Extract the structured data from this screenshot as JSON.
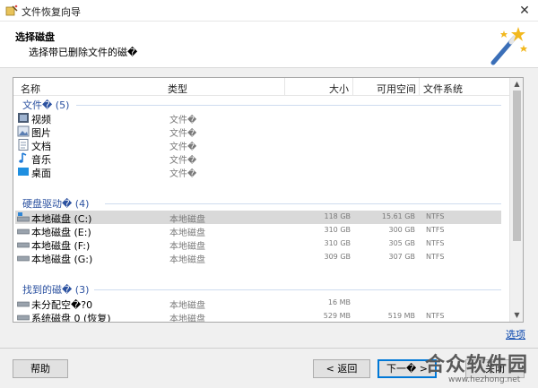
{
  "window": {
    "title": "文件恢复向导",
    "close_glyph": "✕"
  },
  "header": {
    "title": "选择磁盘",
    "subtitle": "选择带已删除文件的磁�"
  },
  "columns": {
    "name": "名称",
    "type": "类型",
    "size": "大小",
    "free": "可用空间",
    "fs": "文件系统"
  },
  "groups": [
    {
      "label": "文件� (5)",
      "rows": [
        {
          "name": "视频",
          "type": "文件�",
          "size": "",
          "free": "",
          "fs": "",
          "icon": "video-icon"
        },
        {
          "name": "图片",
          "type": "文件�",
          "size": "",
          "free": "",
          "fs": "",
          "icon": "picture-icon"
        },
        {
          "name": "文档",
          "type": "文件�",
          "size": "",
          "free": "",
          "fs": "",
          "icon": "document-icon"
        },
        {
          "name": "音乐",
          "type": "文件�",
          "size": "",
          "free": "",
          "fs": "",
          "icon": "music-icon"
        },
        {
          "name": "桌面",
          "type": "文件�",
          "size": "",
          "free": "",
          "fs": "",
          "icon": "desktop-icon"
        }
      ]
    },
    {
      "label": "硬盘驱动� (4)",
      "rows": [
        {
          "name": "本地磁盘 (C:)",
          "type": "本地磁盘",
          "size": "118 GB",
          "free": "15.61 GB",
          "fs": "NTFS",
          "icon": "system-drive-icon",
          "selected": true
        },
        {
          "name": "本地磁盘 (E:)",
          "type": "本地磁盘",
          "size": "310 GB",
          "free": "300 GB",
          "fs": "NTFS",
          "icon": "drive-icon"
        },
        {
          "name": "本地磁盘 (F:)",
          "type": "本地磁盘",
          "size": "310 GB",
          "free": "305 GB",
          "fs": "NTFS",
          "icon": "drive-icon"
        },
        {
          "name": "本地磁盘 (G:)",
          "type": "本地磁盘",
          "size": "309 GB",
          "free": "307 GB",
          "fs": "NTFS",
          "icon": "drive-icon"
        }
      ]
    },
    {
      "label": "找到的磁� (3)",
      "rows": [
        {
          "name": "未分配空�?0",
          "type": "本地磁盘",
          "size": "16 MB",
          "free": "",
          "fs": "",
          "icon": "drive-icon"
        },
        {
          "name": "系统磁盘 0 (恢复)",
          "type": "本地磁盘",
          "size": "529 MB",
          "free": "519 MB",
          "fs": "NTFS",
          "icon": "drive-icon"
        }
      ]
    }
  ],
  "options_link": "选项",
  "buttons": {
    "help": "帮助",
    "back": "< 返回",
    "next": "下一� >",
    "close": "关闭"
  },
  "watermark": {
    "text": "合众软件园",
    "url": "www.hezhong.net"
  },
  "colors": {
    "group_text": "#2b51a0",
    "link": "#0645ad",
    "selected_row": "#d9d9d9",
    "default_button_border": "#0078d7"
  }
}
